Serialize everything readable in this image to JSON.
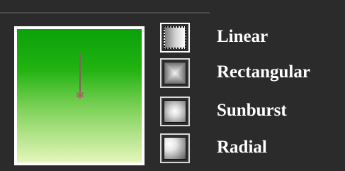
{
  "gradient_types": {
    "selected": "Linear",
    "options": [
      {
        "label": "Linear",
        "icon": "linear-gradient-icon"
      },
      {
        "label": "Rectangular",
        "icon": "rectangular-gradient-icon"
      },
      {
        "label": "Sunburst",
        "icon": "sunburst-gradient-icon"
      },
      {
        "label": "Radial",
        "icon": "radial-gradient-icon"
      }
    ]
  },
  "preview": {
    "start_color": "#0aa10a",
    "end_color": "#e6f6ba",
    "handle_color": "#b06070"
  }
}
